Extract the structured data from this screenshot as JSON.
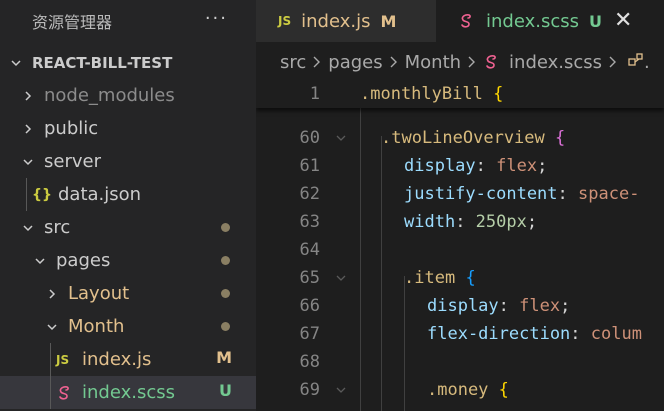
{
  "sidebar": {
    "title": "资源管理器",
    "more_label": "···",
    "project": "REACT-BILL-TEST",
    "tree": [
      {
        "label": "node_modules"
      },
      {
        "label": "public"
      },
      {
        "label": "server"
      },
      {
        "label": "data.json",
        "icon_text": "{}"
      },
      {
        "label": "src"
      },
      {
        "label": "pages"
      },
      {
        "label": "Layout"
      },
      {
        "label": "Month"
      },
      {
        "label": "index.js",
        "icon_text": "JS",
        "status": "M"
      },
      {
        "label": "index.scss",
        "status": "U"
      }
    ]
  },
  "tabs": [
    {
      "icon_text": "JS",
      "label": "index.js",
      "status": "M"
    },
    {
      "label": "index.scss",
      "status": "U",
      "close": "✕"
    }
  ],
  "breadcrumb": {
    "items": [
      "src",
      "pages",
      "Month",
      "index.scss"
    ],
    "tail": "."
  },
  "editor": {
    "sticky": {
      "line": "1",
      "selector": ".monthlyBill",
      "brace": "{"
    },
    "lines": [
      {
        "n": "60",
        "sel": ".twoLineOverview",
        "brace": "{"
      },
      {
        "n": "61",
        "prop": "display",
        "value": "flex"
      },
      {
        "n": "62",
        "prop": "justify-content",
        "value": "space-"
      },
      {
        "n": "63",
        "prop": "width",
        "num": "250",
        "unit": "px"
      },
      {
        "n": "64"
      },
      {
        "n": "65",
        "sel": ".item",
        "brace": "{"
      },
      {
        "n": "66",
        "prop": "display",
        "value": "flex"
      },
      {
        "n": "67",
        "prop": "flex-direction",
        "value": "colum"
      },
      {
        "n": "68"
      },
      {
        "n": "69",
        "sel": ".money",
        "brace": "{"
      }
    ]
  },
  "colors": {
    "modified": "#e2c08d",
    "untracked": "#73c991",
    "selector": "#d7ba7d",
    "property": "#9cdcfe",
    "string_value": "#ce9178",
    "number": "#b5cea8"
  }
}
